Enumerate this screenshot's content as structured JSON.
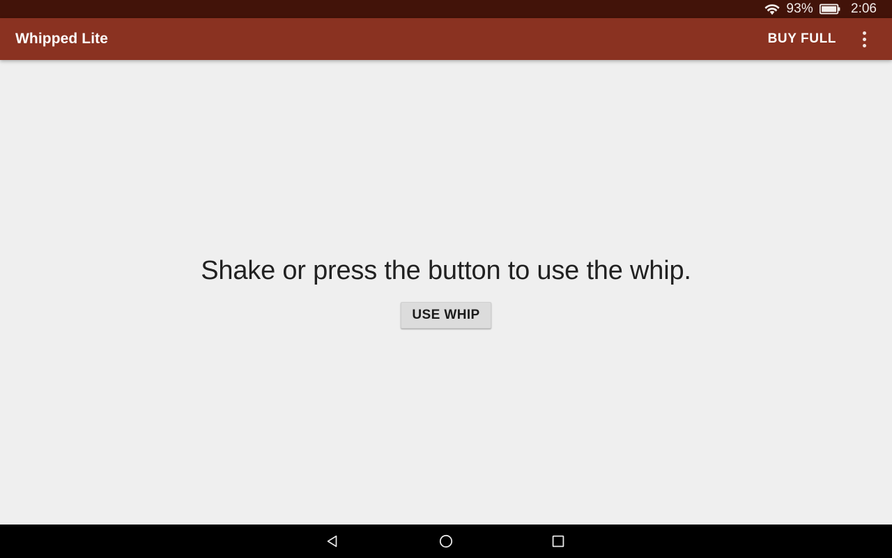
{
  "status_bar": {
    "wifi_icon": "wifi-icon",
    "battery_percent": "93%",
    "battery_icon": "battery-icon",
    "clock": "2:06",
    "background_color": "#421309",
    "text_color": "#f2ece9"
  },
  "app_bar": {
    "title": "Whipped Lite",
    "buy_full_label": "BUY FULL",
    "overflow_icon": "overflow-menu-icon",
    "background_color": "#8a3221",
    "text_color": "#ffffff"
  },
  "content": {
    "instruction": "Shake or press the button to use the whip.",
    "use_whip_label": "USE WHIP",
    "background_color": "#efefef",
    "text_color": "#212121",
    "button_color": "#dcdcdc"
  },
  "nav_bar": {
    "background_color": "#000000",
    "back_icon": "nav-back-icon",
    "home_icon": "nav-home-icon",
    "recents_icon": "nav-recents-icon"
  }
}
